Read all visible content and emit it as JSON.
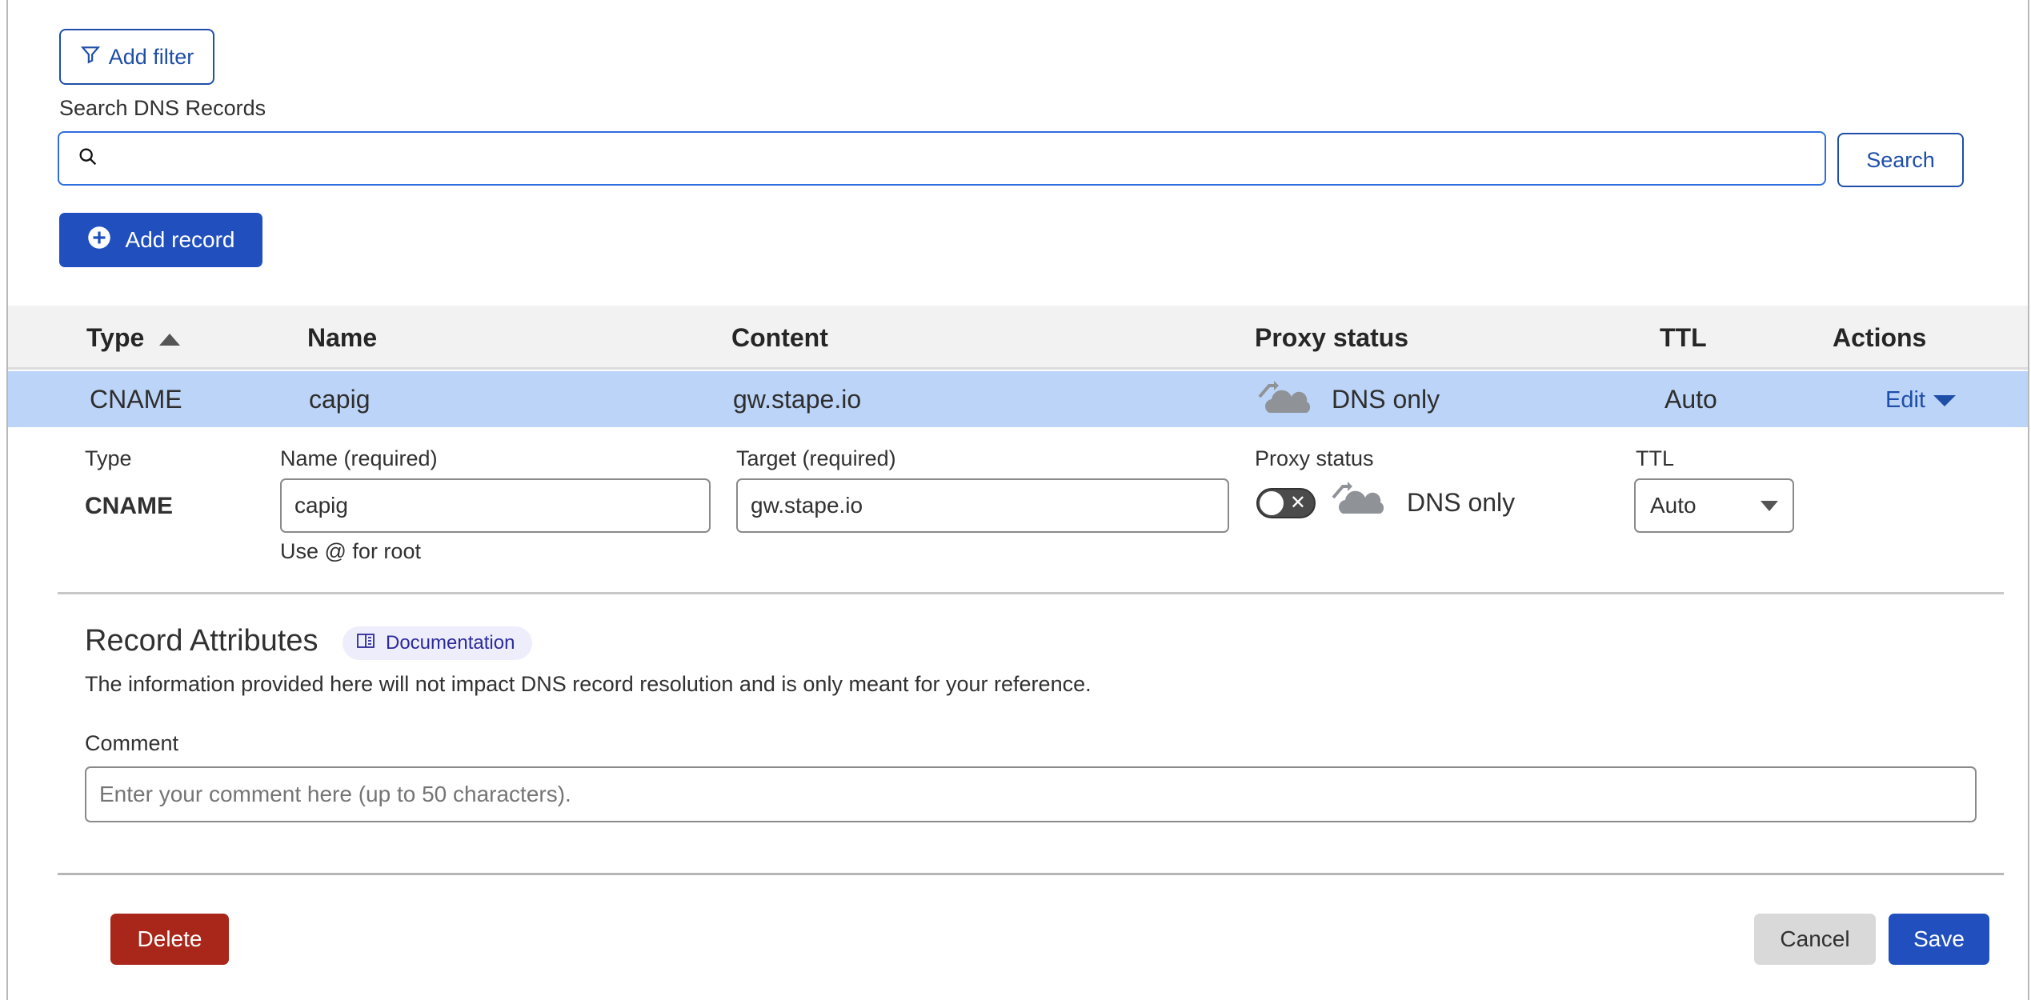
{
  "toolbar": {
    "add_filter_label": "Add filter",
    "search_label": "Search DNS Records",
    "search_value": "",
    "search_button": "Search",
    "add_record_label": "Add record"
  },
  "table": {
    "columns": [
      "Type",
      "Name",
      "Content",
      "Proxy status",
      "TTL",
      "Actions"
    ],
    "sort": {
      "column": "Type",
      "direction": "ascending"
    },
    "rows": [
      {
        "type": "CNAME",
        "name": "capig",
        "content": "gw.stape.io",
        "proxy_status": "DNS only",
        "ttl": "Auto",
        "action": "Edit"
      }
    ]
  },
  "edit_form": {
    "type_label": "Type",
    "type_value": "CNAME",
    "name_label": "Name (required)",
    "name_value": "capig",
    "name_hint": "Use @ for root",
    "target_label": "Target (required)",
    "target_value": "gw.stape.io",
    "proxy_label": "Proxy status",
    "proxy_enabled": false,
    "proxy_value": "DNS only",
    "ttl_label": "TTL",
    "ttl_value": "Auto"
  },
  "attributes": {
    "title": "Record Attributes",
    "doc_label": "Documentation",
    "description": "The information provided here will not impact DNS record resolution and is only meant for your reference.",
    "comment_label": "Comment",
    "comment_placeholder": "Enter your comment here (up to 50 characters).",
    "comment_value": ""
  },
  "actions": {
    "delete_label": "Delete",
    "cancel_label": "Cancel",
    "save_label": "Save"
  },
  "colors": {
    "primary": "#2150be",
    "danger": "#a8261a",
    "row_highlight": "#bcd4f8",
    "header_bg": "#f2f2f2",
    "cancel_bg": "#d9d9d9"
  }
}
